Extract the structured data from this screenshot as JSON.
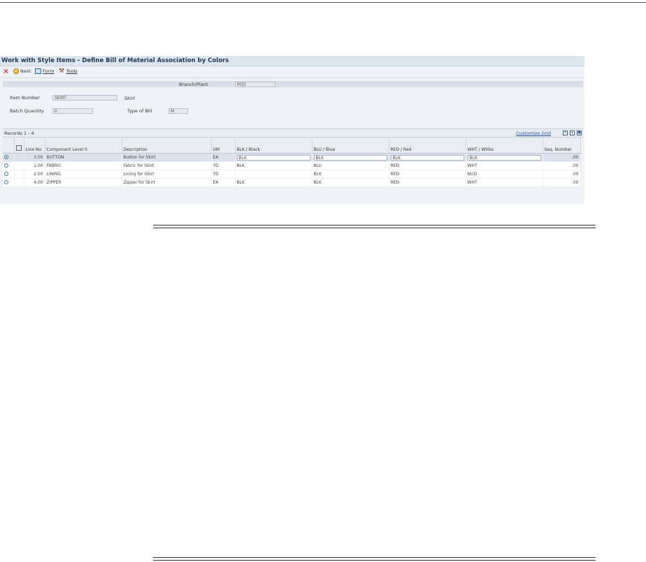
{
  "window": {
    "title": "Work with Style Items - Define Bill of Material Association by Colors"
  },
  "toolbar": {
    "items": [
      {
        "icon": "close-icon",
        "label": ""
      },
      {
        "icon": "next-icon",
        "label": "Next"
      },
      {
        "icon": "form-icon",
        "label": "Form"
      },
      {
        "icon": "tools-icon",
        "label": "Tools"
      }
    ]
  },
  "header": {
    "branch_plant_label": "Branch/Plant",
    "branch_plant_value": "M30",
    "item_number_label": "Item Number",
    "item_number_value": "SKIRT",
    "item_description": "Skirt",
    "batch_quantity_label": "Batch Quantity",
    "batch_quantity_value": "0",
    "type_of_bill_label": "Type of Bill",
    "type_of_bill_value": "M"
  },
  "grid": {
    "records_label": "Records 1 - 4",
    "customize_label": "Customize Grid",
    "columns": [
      "Line No.",
      "Component Level 0",
      "Description",
      "UM",
      "BLK / Black",
      "BLU / Blue",
      "RED / Red",
      "WHT / White",
      "Seq. Number"
    ],
    "rows": [
      {
        "line": "3.00",
        "component": "BUTTON",
        "description": "Button for Skirt",
        "um": "EA",
        "blk": "BLK",
        "blu": "BLK",
        "red": "BLK",
        "wht": "BLK",
        "seq": ".00",
        "selected": true
      },
      {
        "line": "1.00",
        "component": "FABRIC",
        "description": "Fabric for Skirt",
        "um": "YD",
        "blk": "BLK",
        "blu": "BLU",
        "red": "RED",
        "wht": "WHT",
        "seq": ".00",
        "selected": false
      },
      {
        "line": "2.00",
        "component": "LINING",
        "description": "Lining for Skirt",
        "um": "YD",
        "blk": "",
        "blu": "BLK",
        "red": "RED",
        "wht": "NUD",
        "seq": ".00",
        "selected": false
      },
      {
        "line": "4.00",
        "component": "ZIPPER",
        "description": "Zipper for Skirt",
        "um": "EA",
        "blk": "BLK",
        "blu": "BLK",
        "red": "RED",
        "wht": "WHT",
        "seq": ".00",
        "selected": false
      }
    ]
  },
  "colors": {
    "title_text": "#213a5a",
    "selected_row": "#d9e1ec",
    "close_red": "#d2262c",
    "link": "#1f4f99"
  }
}
